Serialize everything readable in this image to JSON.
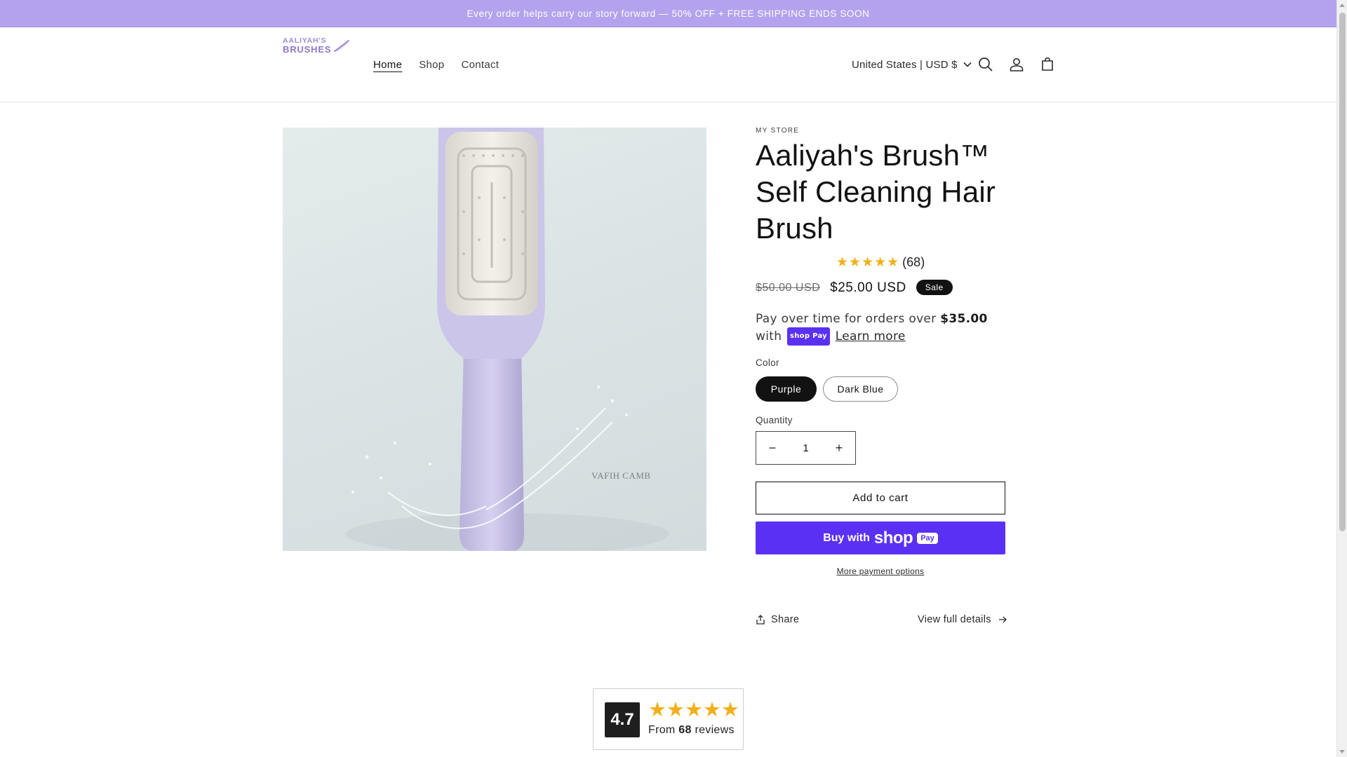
{
  "announcement": "Every order helps carry our story forward — 50% OFF + FREE SHIPPING ENDS SOON",
  "brand": {
    "logo_line1": "AALIYAH'S",
    "logo_line2": "BRUSHES"
  },
  "nav": {
    "items": [
      {
        "label": "Home",
        "active": true
      },
      {
        "label": "Shop",
        "active": false
      },
      {
        "label": "Contact",
        "active": false
      }
    ]
  },
  "header": {
    "country_selector": "United States | USD $",
    "icons": [
      "search-icon",
      "account-icon",
      "cart-icon"
    ]
  },
  "product": {
    "image_watermark": "VAFIH CAMB",
    "vendor": "MY STORE",
    "title": "Aaliyah's Brush™ Self Cleaning Hair Brush",
    "rating_stars": "★★★★★",
    "rating_count": "(68)",
    "compare_price": "$50.00 USD",
    "price": "$25.00 USD",
    "sale_badge": "Sale",
    "installments_text": "Pay over time for orders over",
    "installments_amount": "$35.00",
    "installments_with": "with",
    "installments_shoppay": "shop Pay",
    "installments_learn_more": "Learn more",
    "color_label": "Color",
    "color_options": [
      {
        "label": "Purple",
        "selected": true
      },
      {
        "label": "Dark Blue",
        "selected": false
      }
    ],
    "quantity_label": "Quantity",
    "quantity_value": "1",
    "quantity_decrease": "−",
    "quantity_increase": "+",
    "add_to_cart": "Add to cart",
    "buy_with": "Buy with",
    "buy_shop_word": "shop",
    "buy_pay_word": "Pay",
    "more_payment_options": "More payment options",
    "share": "Share",
    "view_full_details": "View full details"
  },
  "reviews_summary": {
    "score": "4.7",
    "stars": "★★★★★",
    "from_prefix": "From",
    "count": "68",
    "from_suffix": "reviews"
  },
  "colors": {
    "announcement_bg": "#b4a2ee",
    "shop_pay": "#5a31f4",
    "star": "#f1b01b",
    "brush_handle": "#c8c2e6"
  }
}
